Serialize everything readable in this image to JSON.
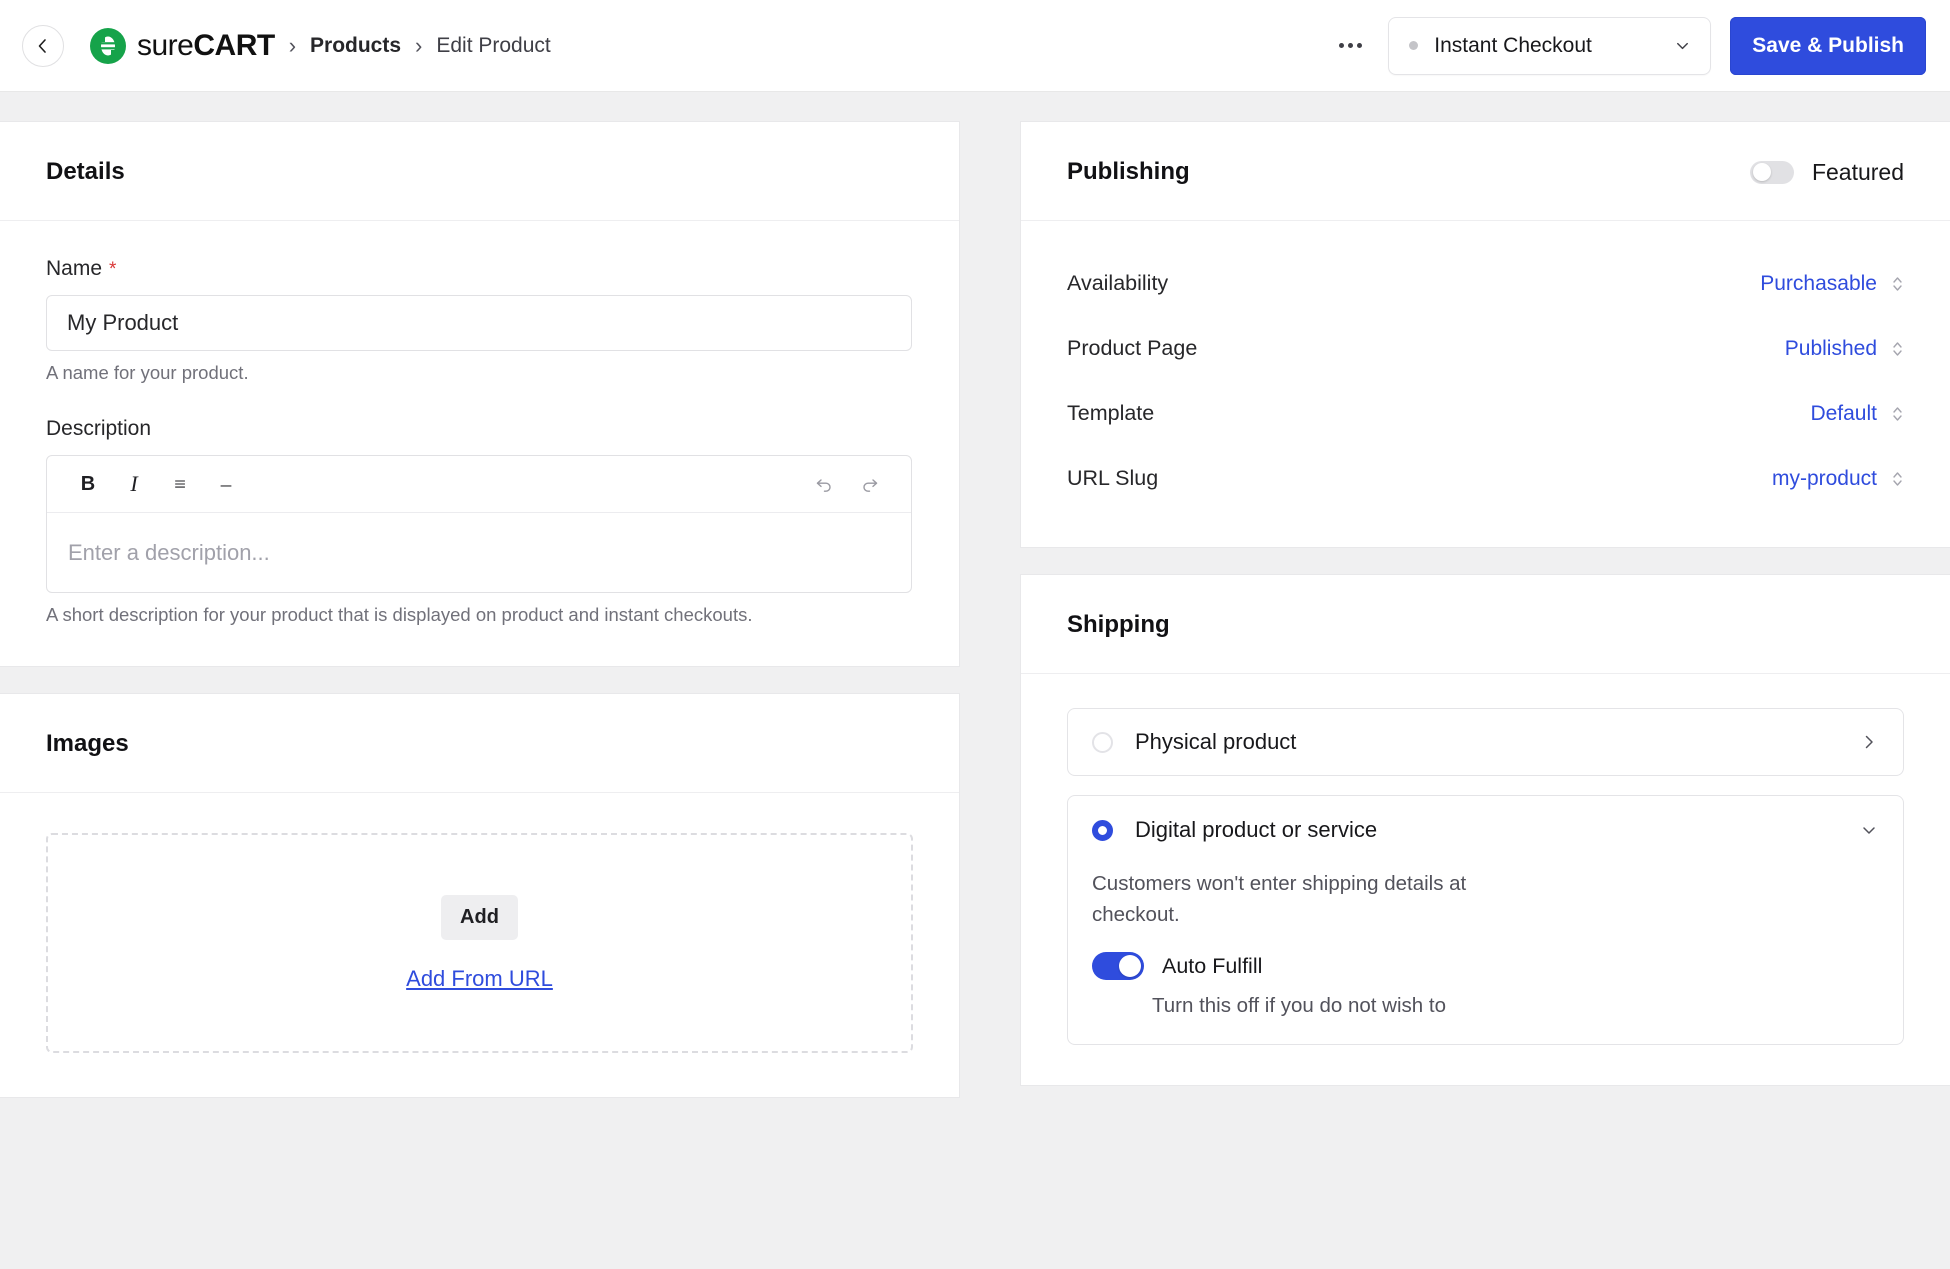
{
  "header": {
    "back_icon": "arrow-left-icon",
    "brand_prefix": "sure",
    "brand_suffix": "CART",
    "breadcrumb": [
      {
        "label": "Products"
      },
      {
        "label": "Edit Product"
      }
    ],
    "separator": "›",
    "kebab_icon": "more-options-icon",
    "status_select": {
      "value": "Instant Checkout",
      "chevron_icon": "chevron-down-icon",
      "dot_icon": "status-dot-icon"
    },
    "publish_button": "Save & Publish",
    "accent_blue": "#2f4cdd",
    "brand_green": "#16a34a"
  },
  "details": {
    "title": "Details",
    "name": {
      "label": "Name",
      "required_mark": "*",
      "value": "My Product",
      "placeholder": "My Product",
      "help": "A name for your product."
    },
    "description": {
      "label": "Description",
      "toolbar": [
        {
          "name": "bold-icon",
          "glyph": "B"
        },
        {
          "name": "italic-icon",
          "glyph": "I"
        },
        {
          "name": "bullet-list-icon",
          "glyph": "≡"
        },
        {
          "name": "horizontal-rule-icon",
          "glyph": "–"
        }
      ],
      "undo_icon": "undo-icon",
      "redo_icon": "redo-icon",
      "placeholder": "Enter a description...",
      "help": "A short description for your product that is displayed on product and instant checkouts."
    }
  },
  "images": {
    "title": "Images",
    "add_button": "Add",
    "add_from_url": "Add From URL"
  },
  "publishing": {
    "title": "Publishing",
    "featured": {
      "label": "Featured",
      "on": false
    },
    "rows": [
      {
        "key": "Availability",
        "value": "Purchasable"
      },
      {
        "key": "Product Page",
        "value": "Published"
      },
      {
        "key": "Template",
        "value": "Default"
      },
      {
        "key": "URL Slug",
        "value": "my-product"
      }
    ],
    "stepper_icon": "stepper-updown-icon"
  },
  "shipping": {
    "title": "Shipping",
    "options": [
      {
        "label": "Physical product",
        "selected": false,
        "arrow_icon": "chevron-right-icon"
      },
      {
        "label": "Digital product or service",
        "selected": true,
        "arrow_icon": "chevron-down-icon",
        "description": "Customers won't enter shipping details at checkout.",
        "auto_fulfill": {
          "label": "Auto Fulfill",
          "on": true,
          "note": "Turn this off if you do not wish to"
        }
      }
    ]
  }
}
